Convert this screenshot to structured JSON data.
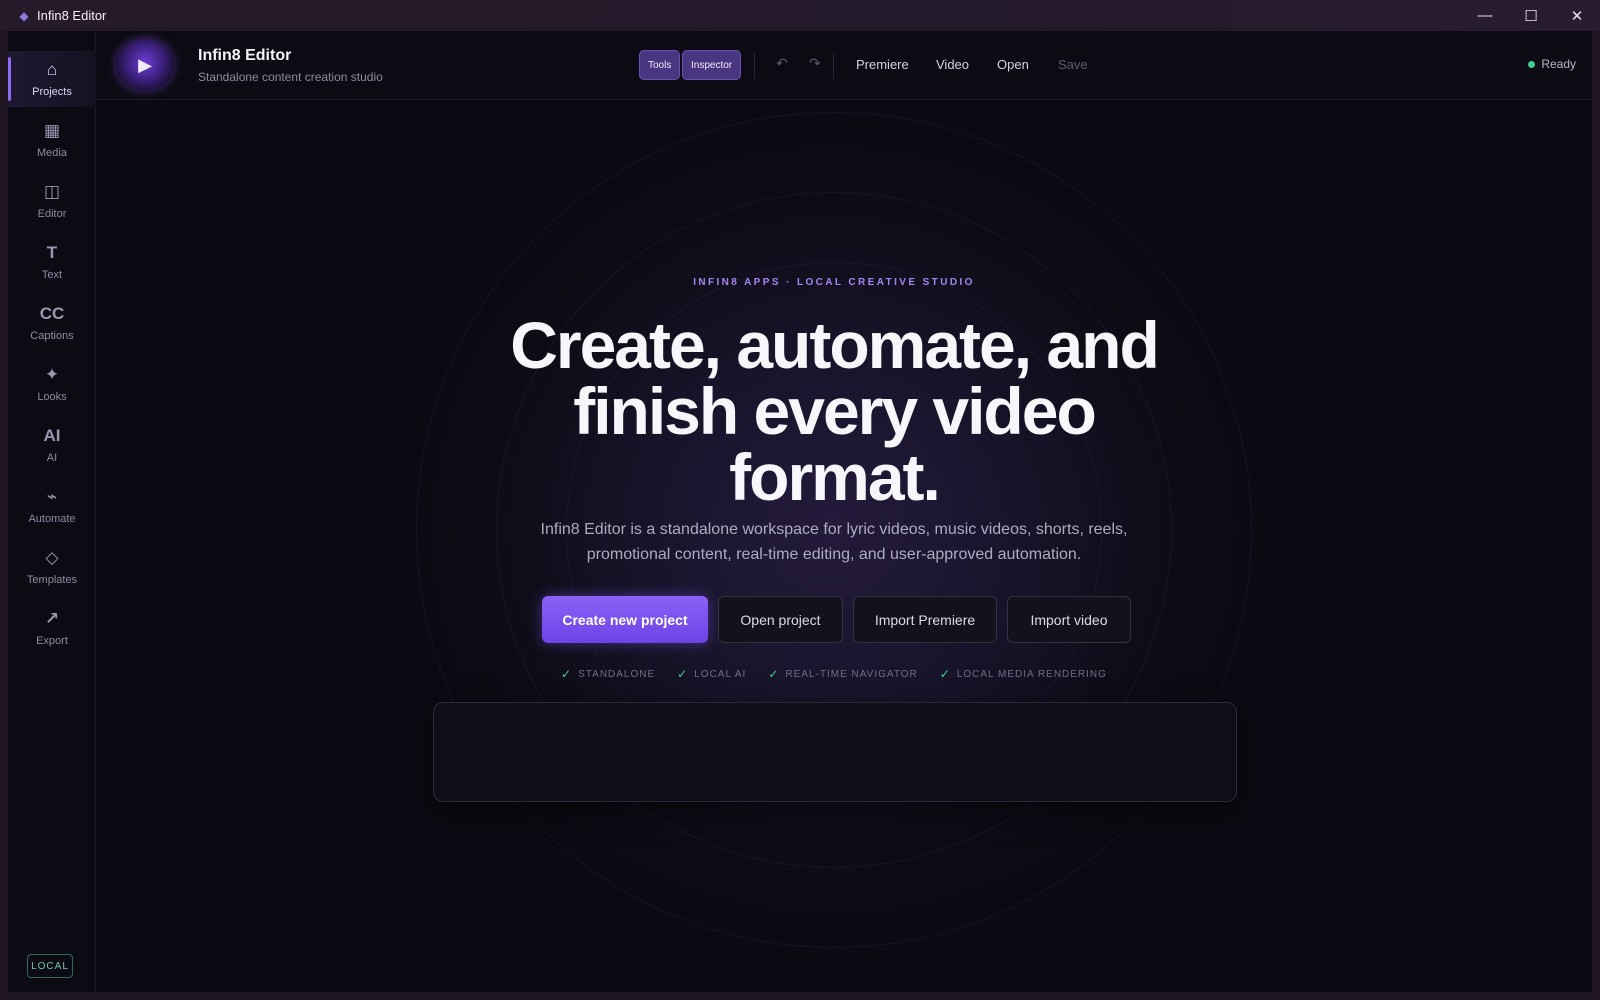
{
  "window": {
    "title": "Infin8 Editor",
    "controls": {
      "minimize": "—",
      "maximize": "☐",
      "close": "✕"
    }
  },
  "sidebar": {
    "items": [
      {
        "label": "Projects",
        "icon": "⌂",
        "icon_name": "home-icon",
        "active": true
      },
      {
        "label": "Media",
        "icon": "▦",
        "icon_name": "grid-icon"
      },
      {
        "label": "Editor",
        "icon": "◫",
        "icon_name": "columns-icon"
      },
      {
        "label": "Text",
        "icon": "T",
        "icon_name": "text-icon"
      },
      {
        "label": "Captions",
        "icon": "CC",
        "icon_name": "captions-icon"
      },
      {
        "label": "Looks",
        "icon": "✦",
        "icon_name": "sparkle-icon"
      },
      {
        "label": "AI",
        "icon": "AI",
        "icon_name": "ai-icon"
      },
      {
        "label": "Automate",
        "icon": "⌁",
        "icon_name": "automate-icon"
      },
      {
        "label": "Templates",
        "icon": "◇",
        "icon_name": "diamond-icon"
      },
      {
        "label": "Export",
        "icon": "↗",
        "icon_name": "export-arrow-icon"
      }
    ],
    "badge": "LOCAL"
  },
  "header": {
    "app_name": "Infin8 Editor",
    "subtitle": "Standalone content creation studio",
    "toggles": {
      "tools": "Tools",
      "inspector": "Inspector"
    },
    "undo_icon": "↶",
    "redo_icon": "↷",
    "menu": {
      "premiere": "Premiere",
      "video": "Video",
      "open": "Open",
      "save": "Save"
    },
    "status": "Ready"
  },
  "hero": {
    "eyebrow": "INFIN8 APPS · LOCAL CREATIVE STUDIO",
    "headline": "Create, automate, and finish every video format.",
    "description": "Infin8 Editor is a standalone workspace for lyric videos, music videos, shorts, reels, promotional content, real-time editing, and user-approved automation.",
    "buttons": {
      "create": "Create new project",
      "open": "Open project",
      "premiere": "Import Premiere",
      "video": "Import video"
    },
    "check_icon": "✓",
    "features": [
      "STANDALONE",
      "LOCAL AI",
      "REAL-TIME NAVIGATOR",
      "LOCAL MEDIA RENDERING"
    ]
  },
  "colors": {
    "accent": "#8b6cf5",
    "status_green": "#3ecf8e",
    "background": "#0b0a12"
  }
}
